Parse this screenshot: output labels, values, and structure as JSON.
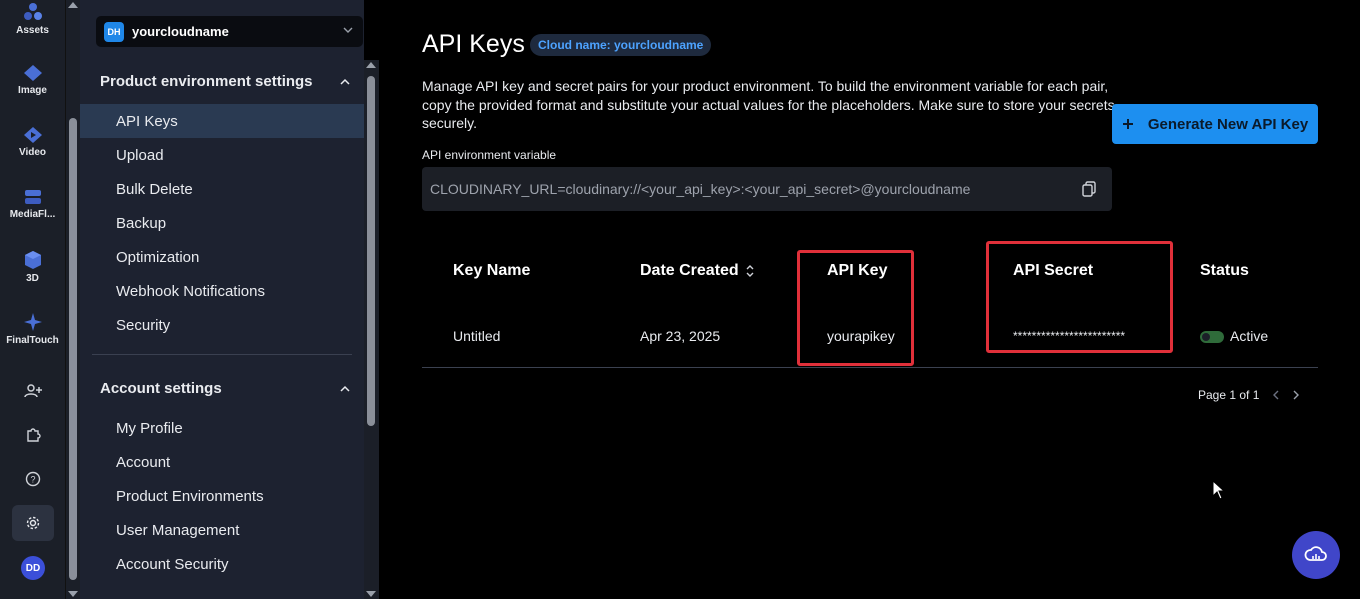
{
  "rail": {
    "items": [
      {
        "label": "Assets",
        "icon": "assets-icon"
      },
      {
        "label": "Image",
        "icon": "image-icon"
      },
      {
        "label": "Video",
        "icon": "video-icon"
      },
      {
        "label": "MediaFl...",
        "icon": "mediaflows-icon"
      },
      {
        "label": "3D",
        "icon": "3d-icon"
      },
      {
        "label": "FinalTouch",
        "icon": "finaltouch-icon"
      }
    ],
    "avatar": "DD"
  },
  "panel": {
    "cloud_badge": "DH",
    "cloud_name": "yourcloudname",
    "product_section": "Product environment settings",
    "product_items": [
      "API Keys",
      "Upload",
      "Bulk Delete",
      "Backup",
      "Optimization",
      "Webhook Notifications",
      "Security"
    ],
    "account_section": "Account settings",
    "account_items": [
      "My Profile",
      "Account",
      "Product Environments",
      "User Management",
      "Account Security"
    ]
  },
  "main": {
    "title": "API Keys",
    "cloud_chip": "Cloud name: yourcloudname",
    "description": "Manage API key and secret pairs for your product environment. To build the environment variable for each pair, copy the provided format and substitute your actual values for the placeholders. Make sure to store your secrets securely.",
    "generate_button": "Generate New API Key",
    "env_label": "API environment variable",
    "env_value": "CLOUDINARY_URL=cloudinary://<your_api_key>:<your_api_secret>@yourcloudname",
    "table": {
      "headers": [
        "Key Name",
        "Date Created",
        "API Key",
        "API Secret",
        "Status"
      ],
      "row": {
        "key_name": "Untitled",
        "date_created": "Apr 23, 2025",
        "api_key": "yourapikey",
        "api_secret": "************************",
        "status": "Active"
      }
    },
    "pager": "Page 1 of 1"
  },
  "colors": {
    "accent": "#1d8ff0",
    "highlight": "#e0303a",
    "active_row": "#2a3a52"
  }
}
